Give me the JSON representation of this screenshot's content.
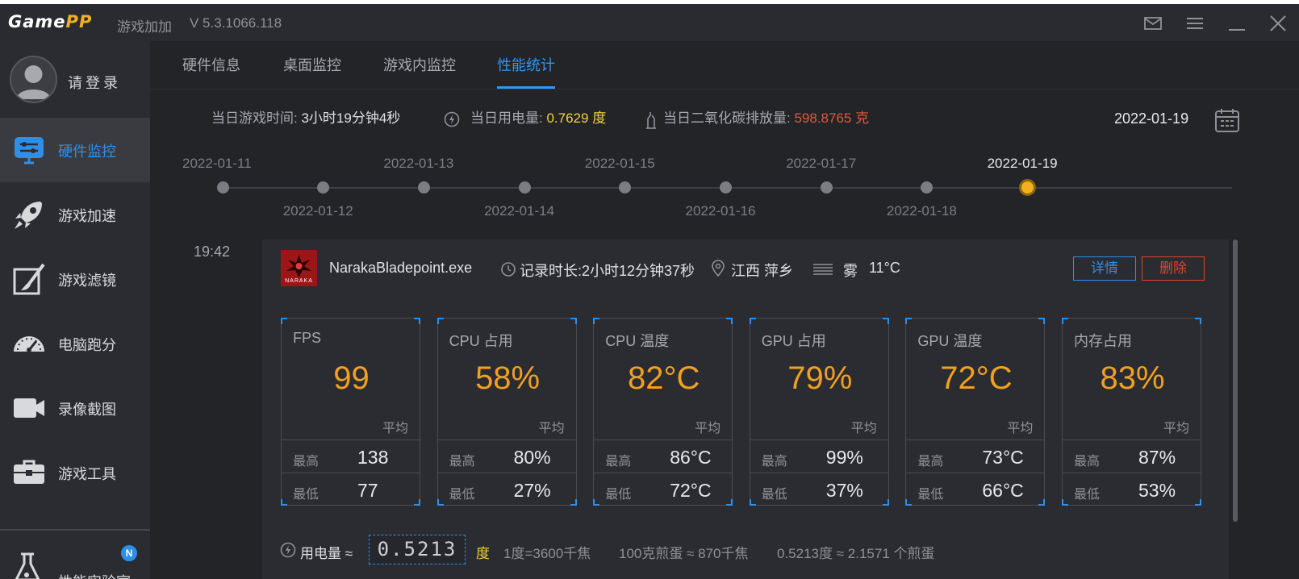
{
  "titlebar": {
    "logo_game": "Game",
    "logo_pp": "PP",
    "app_name": "游戏加加",
    "version": "V 5.3.1066.118"
  },
  "sidebar": {
    "login_label": "请登录",
    "items": [
      {
        "label": "硬件监控",
        "icon": "monitor-settings-icon",
        "active": true
      },
      {
        "label": "游戏加速",
        "icon": "rocket-icon",
        "active": false
      },
      {
        "label": "游戏滤镜",
        "icon": "paint-brush-icon",
        "active": false
      },
      {
        "label": "电脑跑分",
        "icon": "speedometer-icon",
        "active": false
      },
      {
        "label": "录像截图",
        "icon": "video-camera-icon",
        "active": false
      },
      {
        "label": "游戏工具",
        "icon": "toolbox-icon",
        "active": false
      },
      {
        "label": "性能实验室",
        "icon": "flask-icon",
        "active": false,
        "badge": "N"
      }
    ]
  },
  "tabs": [
    {
      "label": "硬件信息",
      "active": false
    },
    {
      "label": "桌面监控",
      "active": false
    },
    {
      "label": "游戏内监控",
      "active": false
    },
    {
      "label": "性能统计",
      "active": true
    }
  ],
  "stats": {
    "play_time_label": "当日游戏时间:",
    "play_time_value": "3小时19分钟4秒",
    "power_label": "当日用电量:",
    "power_value": "0.7629 度",
    "co2_label": "当日二氧化碳排放量:",
    "co2_value": "598.8765 克",
    "current_date": "2022-01-19"
  },
  "timeline": [
    {
      "date": "2022-01-11",
      "label_pos": "above",
      "selected": false
    },
    {
      "date": "2022-01-12",
      "label_pos": "below",
      "selected": false
    },
    {
      "date": "2022-01-13",
      "label_pos": "above",
      "selected": false
    },
    {
      "date": "2022-01-14",
      "label_pos": "below",
      "selected": false
    },
    {
      "date": "2022-01-15",
      "label_pos": "above",
      "selected": false
    },
    {
      "date": "2022-01-16",
      "label_pos": "below",
      "selected": false
    },
    {
      "date": "2022-01-17",
      "label_pos": "above",
      "selected": false
    },
    {
      "date": "2022-01-18",
      "label_pos": "below",
      "selected": false
    },
    {
      "date": "2022-01-19",
      "label_pos": "above",
      "selected": true
    }
  ],
  "record": {
    "time": "19:42",
    "game_exe": "NarakaBladepoint.exe",
    "game_icon_text": "NARAKA",
    "duration": "记录时长:2小时12分钟37秒",
    "location": "江西 萍乡",
    "weather": "雾",
    "temperature": "11°C",
    "detail_button": "详情",
    "delete_button": "删除"
  },
  "labels": {
    "avg": "平均",
    "max": "最高",
    "min": "最低"
  },
  "metrics": [
    {
      "title": "FPS",
      "avg": "99",
      "max": "138",
      "min": "77"
    },
    {
      "title": "CPU 占用",
      "avg": "58%",
      "max": "80%",
      "min": "27%"
    },
    {
      "title": "CPU 温度",
      "avg": "82°C",
      "max": "86°C",
      "min": "72°C"
    },
    {
      "title": "GPU 占用",
      "avg": "79%",
      "max": "99%",
      "min": "37%"
    },
    {
      "title": "GPU 温度",
      "avg": "72°C",
      "max": "73°C",
      "min": "66°C"
    },
    {
      "title": "内存占用",
      "avg": "83%",
      "max": "87%",
      "min": "53%"
    }
  ],
  "power": {
    "label": "用电量 ≈",
    "value": "0.5213",
    "unit": "度",
    "conversion1": "1度=3600千焦",
    "conversion2": "100克煎蛋 ≈ 870千焦",
    "conversion3": "0.5213度 ≈ 2.1571 个煎蛋"
  },
  "colors": {
    "accent": "#2e8fe8",
    "metric_value": "#f0a020",
    "power_value": "#f2d33a",
    "co2_value": "#e05a3a",
    "delete": "#d9452e"
  }
}
